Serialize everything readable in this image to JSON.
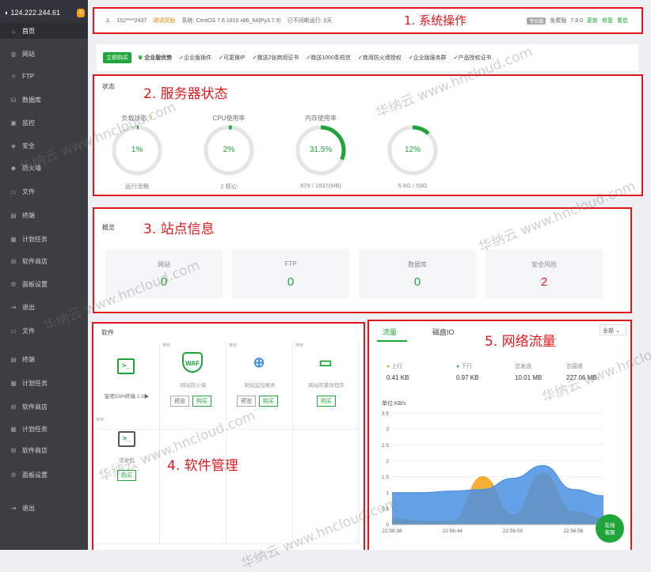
{
  "sidebar": {
    "ip": "124.222.244.61",
    "badge": "0",
    "items": [
      {
        "label": "首页",
        "icon": "home-icon",
        "glyph": "⌂"
      },
      {
        "label": "网站",
        "icon": "globe-icon",
        "glyph": "◍"
      },
      {
        "label": "FTP",
        "icon": "ftp-icon",
        "glyph": "⩟"
      },
      {
        "label": "数据库",
        "icon": "database-icon",
        "glyph": "⛁"
      },
      {
        "label": "监控",
        "icon": "monitor-icon",
        "glyph": "▣"
      },
      {
        "label": "安全",
        "icon": "shield-icon",
        "glyph": "◈"
      },
      {
        "label": "防火墙",
        "icon": "firewall-icon",
        "glyph": "◆"
      },
      {
        "label": "文件",
        "icon": "folder-icon",
        "glyph": "▭"
      },
      {
        "label": "终端",
        "icon": "terminal-icon",
        "glyph": "▤"
      },
      {
        "label": "计划任务",
        "icon": "calendar-icon",
        "glyph": "▦"
      },
      {
        "label": "软件商店",
        "icon": "apps-icon",
        "glyph": "⊞"
      },
      {
        "label": "面板设置",
        "icon": "gear-icon",
        "glyph": "⚙"
      },
      {
        "label": "退出",
        "icon": "logout-icon",
        "glyph": "⇥"
      },
      {
        "label": "文件",
        "icon": "folder-icon",
        "glyph": "▭"
      },
      {
        "label": "终端",
        "icon": "terminal-icon",
        "glyph": "▤"
      },
      {
        "label": "计划任务",
        "icon": "calendar-icon",
        "glyph": "▦"
      },
      {
        "label": "软件商店",
        "icon": "apps-icon",
        "glyph": "⊞"
      },
      {
        "label": "计划任务",
        "icon": "calendar-icon",
        "glyph": "▦"
      },
      {
        "label": "软件商店",
        "icon": "apps-icon",
        "glyph": "⊞"
      },
      {
        "label": "面板设置",
        "icon": "gear-icon",
        "glyph": "⚙"
      },
      {
        "label": "退出",
        "icon": "logout-icon",
        "glyph": "⇥"
      }
    ]
  },
  "topbar": {
    "user": "152****2437",
    "invite": "邀请奖励",
    "system": "系统:  CentOS 7.6.1810 x86_64(Py3.7.9)",
    "uptime": "已不间断运行: 0天",
    "annotation": "1. 系统操作",
    "edition_tag": "专业版",
    "edition": "免费版",
    "version": "7.9.0",
    "update": "更新",
    "repair": "修复",
    "restart": "重启"
  },
  "adbar": {
    "buy": "立即购买",
    "title": "企业版优势",
    "features": [
      "企业版插件",
      "可更换IP",
      "赠送2张商用证书",
      "赠送1000条短信",
      "商用防火墙授权",
      "企业版服务群",
      "产品授权证书"
    ]
  },
  "status": {
    "title": "状态",
    "annotation": "2. 服务器状态",
    "gauges": [
      {
        "label": "负载状态",
        "value": "1%",
        "sub": "运行流畅",
        "fraction": 0.01
      },
      {
        "label": "CPU使用率",
        "value": "2%",
        "sub": "2 核心",
        "fraction": 0.02
      },
      {
        "label": "内存使用率",
        "value": "31.5%",
        "sub": "579 / 1837(MB)",
        "fraction": 0.315
      },
      {
        "label": "",
        "value": "12%",
        "sub": "5.6G / 50G",
        "fraction": 0.12
      }
    ]
  },
  "overview": {
    "title": "概览",
    "annotation": "3. 站点信息",
    "cards": [
      {
        "label": "网站",
        "value": "0",
        "color": "#20a53a"
      },
      {
        "label": "FTP",
        "value": "0",
        "color": "#20a53a"
      },
      {
        "label": "数据库",
        "value": "0",
        "color": "#20a53a"
      },
      {
        "label": "安全风险",
        "value": "2",
        "color": "#e0171c"
      }
    ]
  },
  "software": {
    "title": "软件",
    "annotation": "4. 软件管理",
    "rec": "推荐",
    "ssh_label": "宝塔SSH终端 1.0▶",
    "items": [
      {
        "name": "网站防火墙",
        "buttons": [
          "预览",
          "购买"
        ]
      },
      {
        "name": "网站监控报表",
        "buttons": [
          "预览",
          "购买"
        ]
      },
      {
        "name": "网站防篡改程序",
        "buttons": [
          "购买"
        ]
      }
    ],
    "row2": {
      "name": "堡垒机",
      "button": "购买"
    }
  },
  "network": {
    "annotation": "5. 网络流量",
    "tabs": [
      "流量",
      "磁盘IO"
    ],
    "select": "全部",
    "stats": [
      {
        "label": "上行",
        "value": "0.41 KB",
        "color": "#f5a623"
      },
      {
        "label": "下行",
        "value": "0.97 KB",
        "color": "#4a90e2"
      },
      {
        "label": "总发送",
        "value": "10.01 MB"
      },
      {
        "label": "总接收",
        "value": "227.06 MB"
      }
    ],
    "unit": "单位:KB/s"
  },
  "chart_data": {
    "type": "area",
    "ylabel": "单位:KB/s",
    "ylim": [
      0,
      3.5
    ],
    "yticks": [
      "3.5",
      "3",
      "2.5",
      "2",
      "1.5",
      "1",
      "0.5",
      "0"
    ],
    "xticks": [
      "22:56:38",
      "22:56:44",
      "22:56:50",
      "22:56:56"
    ],
    "x": [
      "22:56:38",
      "22:56:41",
      "22:56:44",
      "22:56:47",
      "22:56:50",
      "22:56:53",
      "22:56:56",
      "22:56:59"
    ],
    "series": [
      {
        "name": "上行",
        "color": "#f5a623",
        "values": [
          0.2,
          0.1,
          0.1,
          1.5,
          0.3,
          1.6,
          0.4,
          0.2
        ]
      },
      {
        "name": "下行",
        "color": "#4a90e2",
        "values": [
          1.0,
          1.0,
          1.05,
          1.1,
          1.45,
          1.85,
          1.1,
          0.9
        ]
      }
    ]
  },
  "chat": {
    "line1": "在线",
    "line2": "客服"
  },
  "watermark": "华纳云 www.hncloud.com"
}
